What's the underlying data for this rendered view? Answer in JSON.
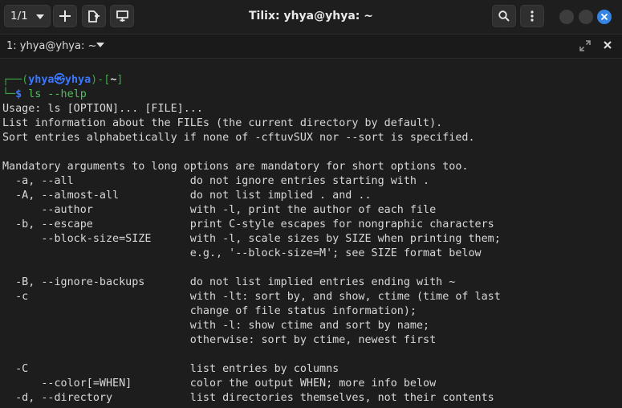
{
  "header": {
    "session_count": "1/1",
    "title": "Tilix: yhya@yhya: ~"
  },
  "tab": {
    "label": "1: yhya@yhya: ~"
  },
  "prompt": {
    "corner": "┌──(",
    "user_host": "yhya㉿yhya",
    "mid": ")-[",
    "path": "~",
    "end": "]",
    "corner2": "└─",
    "dollar": "$",
    "command": "ls --help"
  },
  "output": [
    "Usage: ls [OPTION]... [FILE]...",
    "List information about the FILEs (the current directory by default).",
    "Sort entries alphabetically if none of -cftuvSUX nor --sort is specified.",
    "",
    "Mandatory arguments to long options are mandatory for short options too.",
    "  -a, --all                  do not ignore entries starting with .",
    "  -A, --almost-all           do not list implied . and ..",
    "      --author               with -l, print the author of each file",
    "  -b, --escape               print C-style escapes for nongraphic characters",
    "      --block-size=SIZE      with -l, scale sizes by SIZE when printing them;",
    "                             e.g., '--block-size=M'; see SIZE format below",
    "",
    "  -B, --ignore-backups       do not list implied entries ending with ~",
    "  -c                         with -lt: sort by, and show, ctime (time of last",
    "                             change of file status information);",
    "                             with -l: show ctime and sort by name;",
    "                             otherwise: sort by ctime, newest first",
    "",
    "  -C                         list entries by columns",
    "      --color[=WHEN]         color the output WHEN; more info below",
    "  -d, --directory            list directories themselves, not their contents"
  ]
}
